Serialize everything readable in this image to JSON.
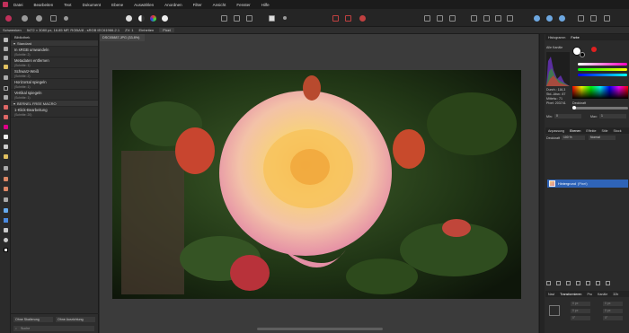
{
  "menubar": {
    "items": [
      "Datei",
      "Bearbeiten",
      "Text",
      "Dokument",
      "Ebene",
      "Auswählen",
      "Anordnen",
      "Filter",
      "Ansicht",
      "Fenster",
      "Hilfe"
    ]
  },
  "contextbar": {
    "mode": "Schwenken",
    "info": "5472 × 3080 px, 16.85 MP, RGBA/8 - sRGB IEC61966-2.1",
    "zoom_label": "ZV: 1",
    "units_label": "Einheiten",
    "units_value": "Pixel"
  },
  "left_panel": {
    "tab": "Bibliothek",
    "group": "Standard",
    "macros": [
      {
        "name": "In sRGB umwandeln",
        "steps": "(Schritte: 2)"
      },
      {
        "name": "Metadaten entfernen",
        "steps": "(Schritte: 1)"
      },
      {
        "name": "Schwarz-Weiß",
        "steps": "(Schritte: 2)"
      },
      {
        "name": "Horizontal spiegeln",
        "steps": "(Schritte: 1)"
      },
      {
        "name": "Vertikal spiegeln",
        "steps": "(Schritte: 1)"
      }
    ],
    "group2": "BERNEL FREE MACRO",
    "macros2": [
      {
        "name": "1-Klick-Bearbeitung",
        "steps": "(Schritte: 20)"
      }
    ],
    "bottom_left_select": "Ohne Skalierung",
    "bottom_right_select": "Ohne Ausrichtung",
    "search_placeholder": "Suche"
  },
  "document": {
    "tab_label": "DSC05887.JPG (33.8%)"
  },
  "right_panel": {
    "top_tabs": [
      "Histogramm",
      "Farbe"
    ],
    "color_label": "Alle Kanäle",
    "stats": {
      "durch": "Durch.: 116,3",
      "std": "Std.-Abw.: 87",
      "mittelw": "Mittelw.: 71",
      "pixel": "Pixel: 203741"
    },
    "deckkraft_label": "Deckkraft",
    "min_label": "Min:",
    "min_value": "0",
    "max_label": "Max:",
    "max_value": "1",
    "mid_tabs": [
      "Anpassung",
      "Ebenen",
      "Effekte",
      "Stile",
      "Stock"
    ],
    "blend_label": "Deckkraft",
    "blend_opacity": "100 %",
    "blend_mode": "Normal",
    "layer_name": "Hintergrund",
    "layer_type": "(Pixel)",
    "bottom_tabs": [
      "Navi",
      "Transformieren",
      "Pro",
      "Kanäle",
      "32b"
    ],
    "transform_fields": [
      "0 px",
      "0 px",
      "0 px",
      "0 px",
      "0°",
      "0°"
    ]
  },
  "colors": {
    "accent": "#2f64b8",
    "logo": "#c0305a"
  }
}
